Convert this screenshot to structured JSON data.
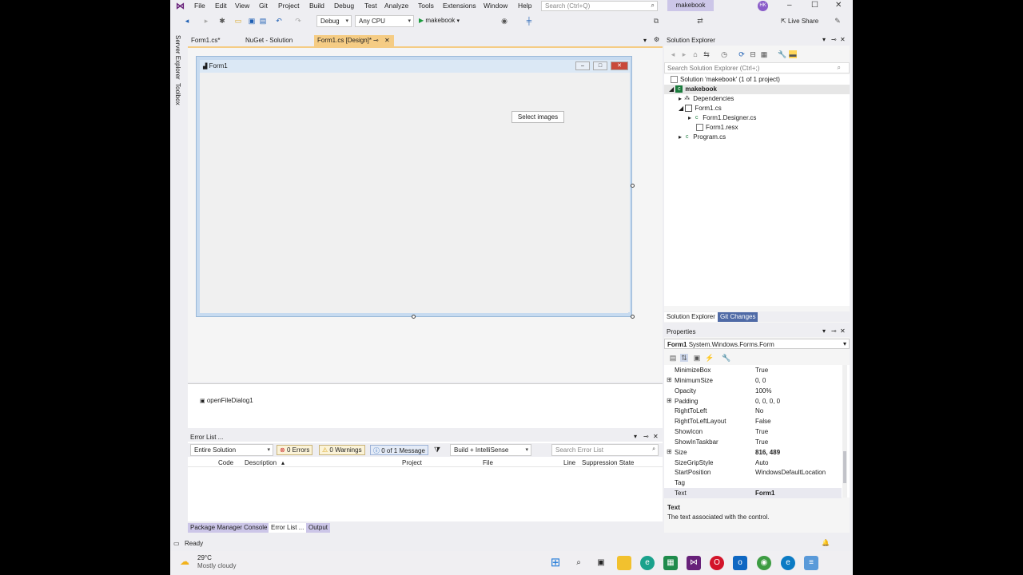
{
  "menu": {
    "items": [
      "File",
      "Edit",
      "View",
      "Git",
      "Project",
      "Build",
      "Debug",
      "Test",
      "Analyze",
      "Tools",
      "Extensions",
      "Window",
      "Help"
    ],
    "search_placeholder": "Search (Ctrl+Q)",
    "solution_name": "makebook",
    "avatar": "HK",
    "live_share": "Live Share"
  },
  "toolbar": {
    "config": "Debug",
    "platform": "Any CPU",
    "run_target": "makebook"
  },
  "sidestrip": {
    "server_explorer": "Server Explorer",
    "toolbox": "Toolbox"
  },
  "doc_tabs": [
    "Form1.cs*",
    "NuGet - Solution",
    "Form1.cs [Design]*"
  ],
  "designer": {
    "form_title": "Form1",
    "button_text": "Select images",
    "tray_component": "openFileDialog1"
  },
  "error_list": {
    "title": "Error List ...",
    "scope": "Entire Solution",
    "errors": "0 Errors",
    "warnings": "0 Warnings",
    "messages": "0 of 1 Message",
    "build_filter": "Build + IntelliSense",
    "search_placeholder": "Search Error List",
    "columns": [
      "Code",
      "Description",
      "Project",
      "File",
      "Line",
      "Suppression State"
    ]
  },
  "bottom_tabs": [
    "Package Manager Console",
    "Error List ...",
    "Output"
  ],
  "solution_explorer": {
    "title": "Solution Explorer",
    "search_placeholder": "Search Solution Explorer (Ctrl+;)",
    "tree": [
      {
        "label": "Solution 'makebook' (1 of 1 project)"
      },
      {
        "label": "makebook"
      },
      {
        "label": "Dependencies"
      },
      {
        "label": "Form1.cs"
      },
      {
        "label": "Form1.Designer.cs"
      },
      {
        "label": "Form1.resx"
      },
      {
        "label": "Program.cs"
      }
    ],
    "tabs": [
      "Solution Explorer",
      "Git Changes"
    ]
  },
  "properties": {
    "title": "Properties",
    "object_name": "Form1",
    "object_type": "System.Windows.Forms.Form",
    "rows": [
      {
        "name": "MinimizeBox",
        "value": "True"
      },
      {
        "name": "MinimumSize",
        "value": "0, 0"
      },
      {
        "name": "Opacity",
        "value": "100%"
      },
      {
        "name": "Padding",
        "value": "0, 0, 0, 0"
      },
      {
        "name": "RightToLeft",
        "value": "No"
      },
      {
        "name": "RightToLeftLayout",
        "value": "False"
      },
      {
        "name": "ShowIcon",
        "value": "True"
      },
      {
        "name": "ShowInTaskbar",
        "value": "True"
      },
      {
        "name": "Size",
        "value": "816, 489"
      },
      {
        "name": "SizeGripStyle",
        "value": "Auto"
      },
      {
        "name": "StartPosition",
        "value": "WindowsDefaultLocation"
      },
      {
        "name": "Tag",
        "value": ""
      },
      {
        "name": "Text",
        "value": "Form1"
      }
    ],
    "desc_title": "Text",
    "desc_body": "The text associated with the control."
  },
  "status": {
    "text": "Ready"
  },
  "taskbar": {
    "temp": "29°C",
    "weather": "Mostly cloudy"
  }
}
